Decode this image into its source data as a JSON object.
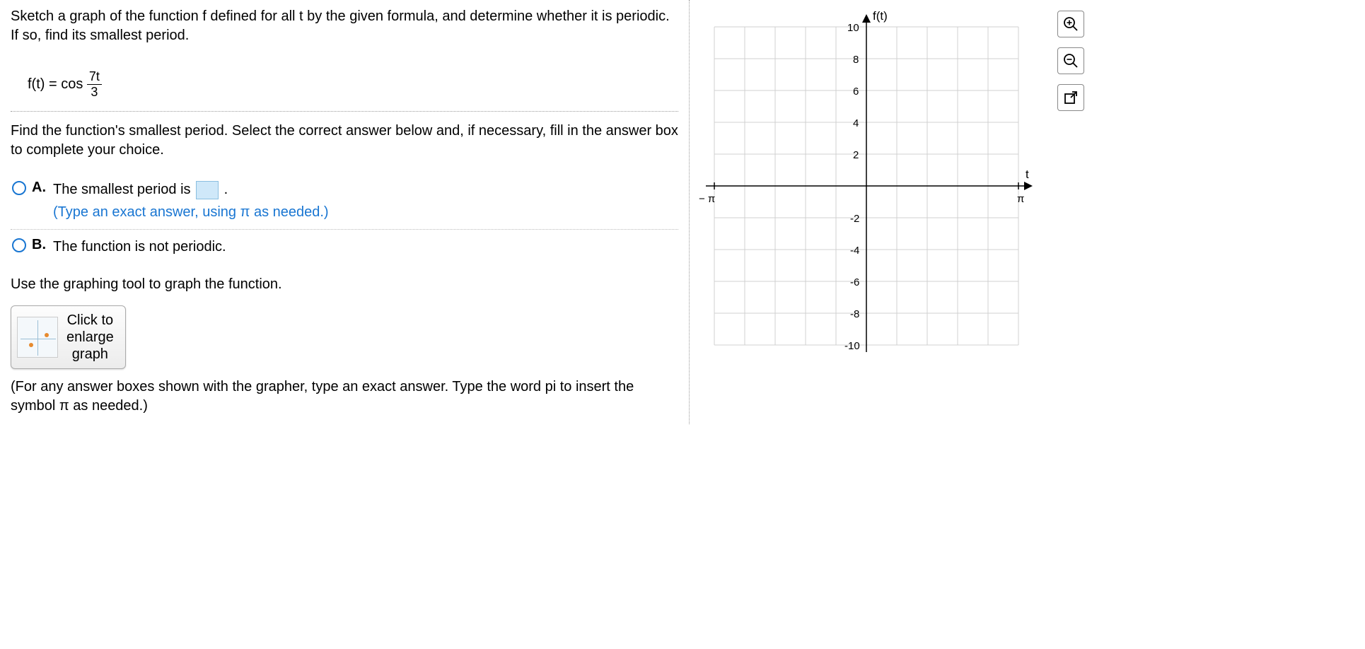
{
  "problem": {
    "intro": "Sketch a graph of the function f defined for all t by the given formula, and determine whether it is periodic. If so, find its smallest period.",
    "formula_lhs": "f(t) = cos",
    "formula_num": "7t",
    "formula_den": "3",
    "instruction": "Find the function's smallest period. Select the correct answer below and, if necessary, fill in the answer box to complete your choice."
  },
  "choices": {
    "a": {
      "letter": "A.",
      "text_before": "The smallest period is ",
      "text_after": " .",
      "hint": "(Type an exact answer, using π as needed.)"
    },
    "b": {
      "letter": "B.",
      "text": "The function is not periodic."
    }
  },
  "graph_prompt": "Use the graphing tool to graph the function.",
  "graph_button_label": "Click to\nenlarge\ngraph",
  "grapher_note": "(For any answer boxes shown with the grapher, type an exact answer. Type the word pi to insert the symbol π as needed.)",
  "chart_data": {
    "type": "empty-grid",
    "x_axis": {
      "label": "t",
      "min": -3.14159,
      "max": 3.14159,
      "tick_left": "− π",
      "tick_right": "π"
    },
    "y_axis": {
      "label": "f(t)",
      "ticks": [
        -10,
        -8,
        -6,
        -4,
        -2,
        2,
        4,
        6,
        8,
        10
      ]
    }
  },
  "tools": {
    "zoom_in": "zoom-in",
    "zoom_out": "zoom-out",
    "popout": "popout"
  }
}
